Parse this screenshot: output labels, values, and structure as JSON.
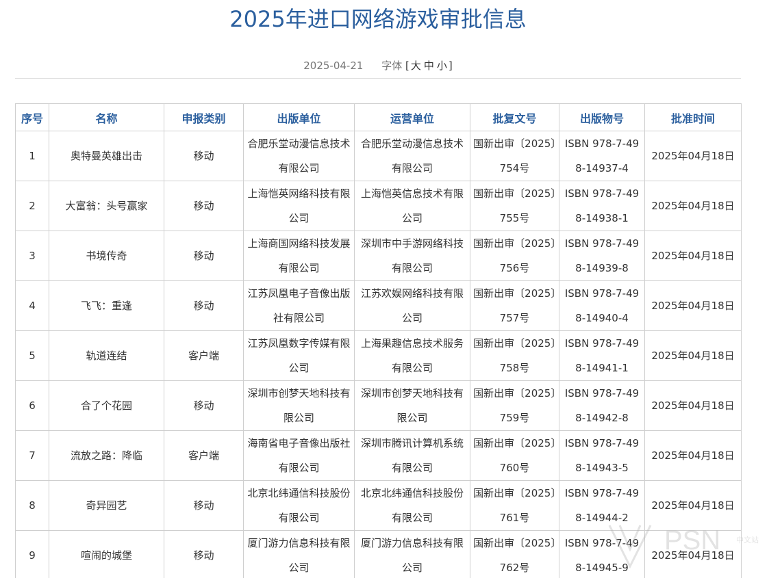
{
  "header": {
    "title": "2025年进口网络游戏审批信息",
    "date": "2025-04-21",
    "font_label": "字体",
    "font_open": "[",
    "font_large": "大",
    "font_medium": "中",
    "font_small": "小",
    "font_close": "]"
  },
  "table": {
    "columns": [
      "序号",
      "名称",
      "申报类别",
      "出版单位",
      "运营单位",
      "批复文号",
      "出版物号",
      "批准时间"
    ],
    "rows": [
      [
        "1",
        "奥特曼英雄出击",
        "移动",
        "合肥乐堂动漫信息技术有限公司",
        "合肥乐堂动漫信息技术有限公司",
        "国新出审〔2025〕754号",
        "ISBN 978-7-498-14937-4",
        "2025年04月18日"
      ],
      [
        "2",
        "大富翁：头号赢家",
        "移动",
        "上海恺英网络科技有限公司",
        "上海恺英信息技术有限公司",
        "国新出审〔2025〕755号",
        "ISBN 978-7-498-14938-1",
        "2025年04月18日"
      ],
      [
        "3",
        "书境传奇",
        "移动",
        "上海商国网络科技发展有限公司",
        "深圳市中手游网络科技有限公司",
        "国新出审〔2025〕756号",
        "ISBN 978-7-498-14939-8",
        "2025年04月18日"
      ],
      [
        "4",
        "飞飞：重逢",
        "移动",
        "江苏凤凰电子音像出版社有限公司",
        "江苏欢娱网络科技有限公司",
        "国新出审〔2025〕757号",
        "ISBN 978-7-498-14940-4",
        "2025年04月18日"
      ],
      [
        "5",
        "轨道连结",
        "客户端",
        "江苏凤凰数字传媒有限公司",
        "上海果趣信息技术服务有限公司",
        "国新出审〔2025〕758号",
        "ISBN 978-7-498-14941-1",
        "2025年04月18日"
      ],
      [
        "6",
        "合了个花园",
        "移动",
        "深圳市创梦天地科技有限公司",
        "深圳市创梦天地科技有限公司",
        "国新出审〔2025〕759号",
        "ISBN 978-7-498-14942-8",
        "2025年04月18日"
      ],
      [
        "7",
        "流放之路：降临",
        "客户端",
        "海南省电子音像出版社有限公司",
        "深圳市腾讯计算机系统有限公司",
        "国新出审〔2025〕760号",
        "ISBN 978-7-498-14943-5",
        "2025年04月18日"
      ],
      [
        "8",
        "奇异园艺",
        "移动",
        "北京北纬通信科技股份有限公司",
        "北京北纬通信科技股份有限公司",
        "国新出审〔2025〕761号",
        "ISBN 978-7-498-14944-2",
        "2025年04月18日"
      ],
      [
        "9",
        "喧闹的城堡",
        "移动",
        "厦门游力信息科技有限公司",
        "厦门游力信息科技有限公司",
        "国新出审〔2025〕762号",
        "ISBN 978-7-498-14945-9",
        "2025年04月18日"
      ]
    ]
  },
  "watermark": {
    "text": "PSN",
    "subtext": "中文站"
  },
  "colors": {
    "title": "#2b5f9e",
    "header_text": "#2b5f9e",
    "border": "#cfcfcf",
    "body_text": "#333333"
  }
}
